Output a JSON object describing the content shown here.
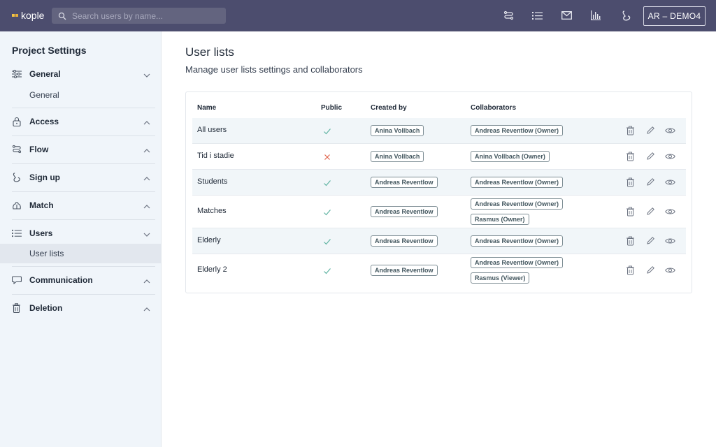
{
  "app": {
    "logo_text": "kople"
  },
  "header": {
    "search_placeholder": "Search users by name...",
    "icons": [
      "flow-icon",
      "list-icon",
      "mail-icon",
      "chart-icon",
      "signup-icon"
    ],
    "account_label": "AR – DEMO4"
  },
  "sidebar": {
    "title": "Project Settings",
    "sections": [
      {
        "label": "General",
        "icon": "sliders-icon",
        "expanded": true,
        "sub": [
          "General"
        ]
      },
      {
        "label": "Access",
        "icon": "lock-icon",
        "expanded": false
      },
      {
        "label": "Flow",
        "icon": "flow-icon",
        "expanded": false
      },
      {
        "label": "Sign up",
        "icon": "signup-icon",
        "expanded": false
      },
      {
        "label": "Match",
        "icon": "match-icon",
        "expanded": false
      },
      {
        "label": "Users",
        "icon": "list-icon",
        "expanded": true,
        "sub": [
          "User lists"
        ],
        "active_sub": "User lists"
      },
      {
        "label": "Communication",
        "icon": "chat-icon",
        "expanded": false
      },
      {
        "label": "Deletion",
        "icon": "trash-icon",
        "expanded": false
      }
    ]
  },
  "main": {
    "title": "User lists",
    "subtitle": "Manage user lists settings and collaborators",
    "table": {
      "headers": {
        "name": "Name",
        "public": "Public",
        "created_by": "Created by",
        "collaborators": "Collaborators"
      },
      "rows": [
        {
          "name": "All users",
          "public": true,
          "created_by": "Anina Vollbach",
          "collaborators": [
            "Andreas Reventlow (Owner)"
          ]
        },
        {
          "name": "Tid i stadie",
          "public": false,
          "created_by": "Anina Vollbach",
          "collaborators": [
            "Anina Vollbach (Owner)"
          ]
        },
        {
          "name": "Students",
          "public": true,
          "created_by": "Andreas Reventlow",
          "collaborators": [
            "Andreas Reventlow (Owner)"
          ]
        },
        {
          "name": "Matches",
          "public": true,
          "created_by": "Andreas Reventlow",
          "collaborators": [
            "Andreas Reventlow (Owner)",
            "Rasmus (Owner)"
          ]
        },
        {
          "name": "Elderly",
          "public": true,
          "created_by": "Andreas Reventlow",
          "collaborators": [
            "Andreas Reventlow (Owner)"
          ]
        },
        {
          "name": "Elderly 2",
          "public": true,
          "created_by": "Andreas Reventlow",
          "collaborators": [
            "Andreas Reventlow (Owner)",
            "Rasmus (Viewer)"
          ]
        }
      ],
      "row_actions": [
        "delete-icon",
        "edit-icon",
        "view-icon"
      ]
    }
  },
  "colors": {
    "header_bg": "#4c4d6e",
    "sidebar_bg": "#f0f5fa",
    "check": "#5fb3a2",
    "cross": "#e0624a",
    "chip_border": "#7d8d94"
  }
}
